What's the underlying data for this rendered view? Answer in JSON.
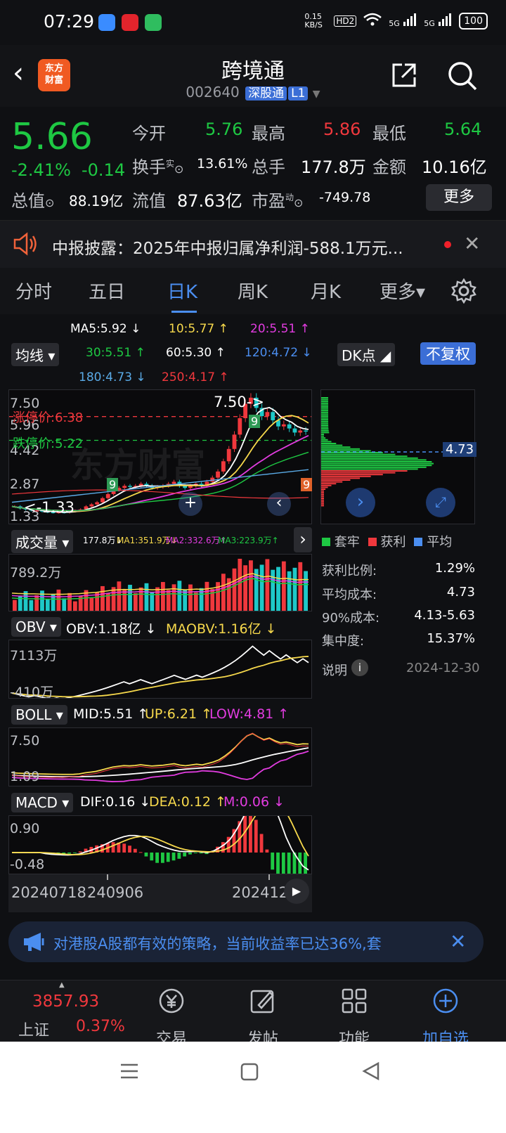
{
  "status": {
    "time": "07:29",
    "net_speed": "0.15 KB/S",
    "hd": "HD2",
    "sig1": "5G",
    "sig2": "5G",
    "battery": "100"
  },
  "header": {
    "back": "‹",
    "logo_line1": "东方",
    "logo_line2": "财富",
    "title": "跨境通",
    "code": "002640",
    "exchange": "深股通",
    "level": "L1"
  },
  "quote": {
    "price": "5.66",
    "change_pct": "-2.41%",
    "change": "-0.14",
    "open_label": "今开",
    "open": "5.76",
    "high_label": "最高",
    "high": "5.86",
    "low_label": "最低",
    "low": "5.64",
    "turnover_label": "换手",
    "turnover_sup": "实",
    "turnover": "13.61%",
    "volume_label": "总手",
    "volume": "177.8万",
    "amount_label": "金额",
    "amount": "10.16亿",
    "mktcap_label": "总值",
    "mktcap": "88.19亿",
    "float_label": "流值",
    "float": "87.63亿",
    "pe_label": "市盈",
    "pe_sup": "动",
    "pe": "-749.78",
    "more": "更多"
  },
  "notice": {
    "text": "中报披露：2025年中报归属净利润-588.1万元...",
    "close": "✕"
  },
  "tabs": [
    {
      "label": "分时"
    },
    {
      "label": "五日"
    },
    {
      "label": "日K"
    },
    {
      "label": "周K"
    },
    {
      "label": "月K"
    },
    {
      "label": "更多▾"
    }
  ],
  "ma": {
    "ma5": "MA5:5.92 ↓",
    "ma10": "10:5.77 ↑",
    "ma20": "20:5.51 ↑",
    "ma30": "30:5.51 ↑",
    "ma60": "60:5.30 ↑",
    "ma120": "120:4.72 ↓",
    "ma180": "180:4.73 ↓",
    "ma250": "250:4.17 ↑",
    "mode": "均线 ▾",
    "dk": "DK点 ◢",
    "fq": "不复权"
  },
  "kline": {
    "y_labels": [
      "7.50",
      "5.96",
      "4.42",
      "2.87",
      "1.33"
    ],
    "limit_up": "涨停价:6.38",
    "limit_down": "跌停价:5.22",
    "high_marker": "7.50->",
    "low_marker": "<-1.33",
    "watermark": "东方财富",
    "close_series": [
      2.0,
      1.9,
      1.85,
      1.8,
      1.8,
      1.75,
      1.72,
      1.7,
      1.72,
      1.7,
      1.75,
      1.8,
      1.85,
      2.0,
      2.1,
      2.2,
      2.4,
      2.6,
      2.8,
      2.9,
      3.0,
      2.95,
      3.0,
      3.1,
      3.0,
      2.9,
      2.95,
      3.0,
      3.1,
      3.2,
      3.0,
      2.9,
      3.0,
      3.1,
      3.0,
      3.2,
      3.4,
      3.7,
      4.2,
      4.8,
      5.5,
      6.3,
      7.0,
      7.3,
      6.8,
      6.4,
      6.6,
      6.2,
      5.9,
      6.0,
      5.8,
      5.6,
      5.7,
      5.66
    ]
  },
  "volume": {
    "mode": "成交量 ▾",
    "vol": "177.8万↓",
    "ma1": "MA1:351.9万↓",
    "ma2": "MA2:332.6万↑",
    "ma3": "MA3:223.9万↑",
    "y_label": "789.2万"
  },
  "obv": {
    "mode": "OBV ▾",
    "obv": "OBV:1.18亿 ↓",
    "maobv": "MAOBV:1.16亿 ↓",
    "y_top": "7113万",
    "y_bottom": "-410万"
  },
  "boll": {
    "mode": "BOLL ▾",
    "mid": "MID:5.51 ↑",
    "up": "UP:6.21 ↑",
    "low": "LOW:4.81 ↑",
    "y_top": "7.50",
    "y_bottom": "1.09"
  },
  "macd": {
    "mode": "MACD ▾",
    "dif": "DIF:0.16 ↓",
    "dea": "DEA:0.12 ↑",
    "m": "M:0.06 ↓",
    "y_top": "0.90",
    "y_bottom": "-0.48"
  },
  "dates": [
    "20240718",
    "240906",
    "202412"
  ],
  "chips": {
    "value": "4.73",
    "legend": [
      {
        "label": "套牢",
        "color": "#1ec843"
      },
      {
        "label": "获利",
        "color": "#f0383d"
      },
      {
        "label": "平均",
        "color": "#4b8ef0"
      }
    ],
    "rows": [
      {
        "label": "获利比例:",
        "value": "1.29%"
      },
      {
        "label": "平均成本:",
        "value": "4.73"
      },
      {
        "label": "90%成本:",
        "value": "4.13-5.63"
      },
      {
        "label": "集中度:",
        "value": "15.37%"
      }
    ],
    "note_label": "说明",
    "note_date": "2024-12-30"
  },
  "ad": {
    "text": "对港股A股都有效的策略，当前收益率已达36%,套"
  },
  "nav": {
    "index_value": "3857.93",
    "index_name": "上证",
    "index_pct": "0.37%",
    "items": [
      {
        "label": "交易"
      },
      {
        "label": "发帖"
      },
      {
        "label": "功能"
      },
      {
        "label": "加自选"
      }
    ]
  }
}
